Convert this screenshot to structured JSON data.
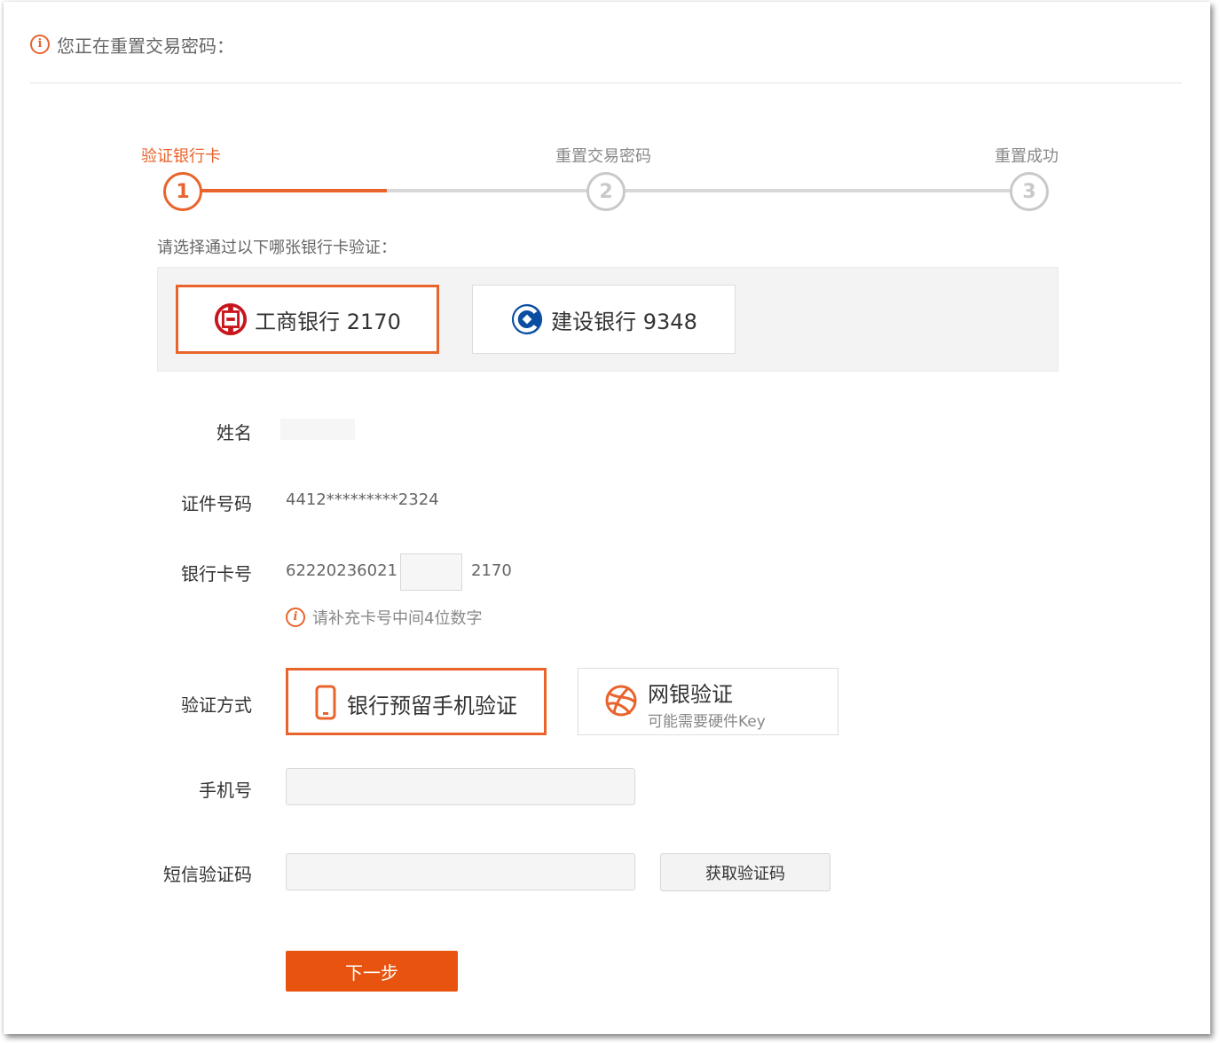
{
  "colors": {
    "accent": "#e8642c",
    "primary_button": "#e8540f"
  },
  "header": {
    "notice": "您正在重置交易密码：",
    "notice_icon": "info-icon"
  },
  "stepper": {
    "steps": [
      {
        "num": "1",
        "label": "验证银行卡",
        "active": true
      },
      {
        "num": "2",
        "label": "重置交易密码",
        "active": false
      },
      {
        "num": "3",
        "label": "重置成功",
        "active": false
      }
    ]
  },
  "card_select": {
    "prompt": "请选择通过以下哪张银行卡验证：",
    "cards": [
      {
        "name": "工商银行 2170",
        "icon": "icbc-logo-icon",
        "selected": true
      },
      {
        "name": "建设银行 9348",
        "icon": "ccb-logo-icon",
        "selected": false
      }
    ]
  },
  "form": {
    "name": {
      "label": "姓名",
      "value": ""
    },
    "id_number": {
      "label": "证件号码",
      "value": "4412*********2324"
    },
    "card_number": {
      "label": "银行卡号",
      "prefix": "62220236021",
      "middle": "",
      "suffix": "2170",
      "hint": "请补充卡号中间4位数字",
      "hint_icon": "info-icon"
    },
    "method": {
      "label": "验证方式",
      "options": [
        {
          "title": "银行预留手机验证",
          "subtitle": "",
          "icon": "mobile-phone-icon",
          "selected": true
        },
        {
          "title": "网银验证",
          "subtitle": "可能需要硬件Key",
          "icon": "globe-ball-icon",
          "selected": false
        }
      ]
    },
    "phone": {
      "label": "手机号",
      "value": "",
      "placeholder": ""
    },
    "sms": {
      "label": "短信验证码",
      "value": "",
      "placeholder": "",
      "button": "获取验证码"
    }
  },
  "actions": {
    "next": "下一步"
  }
}
